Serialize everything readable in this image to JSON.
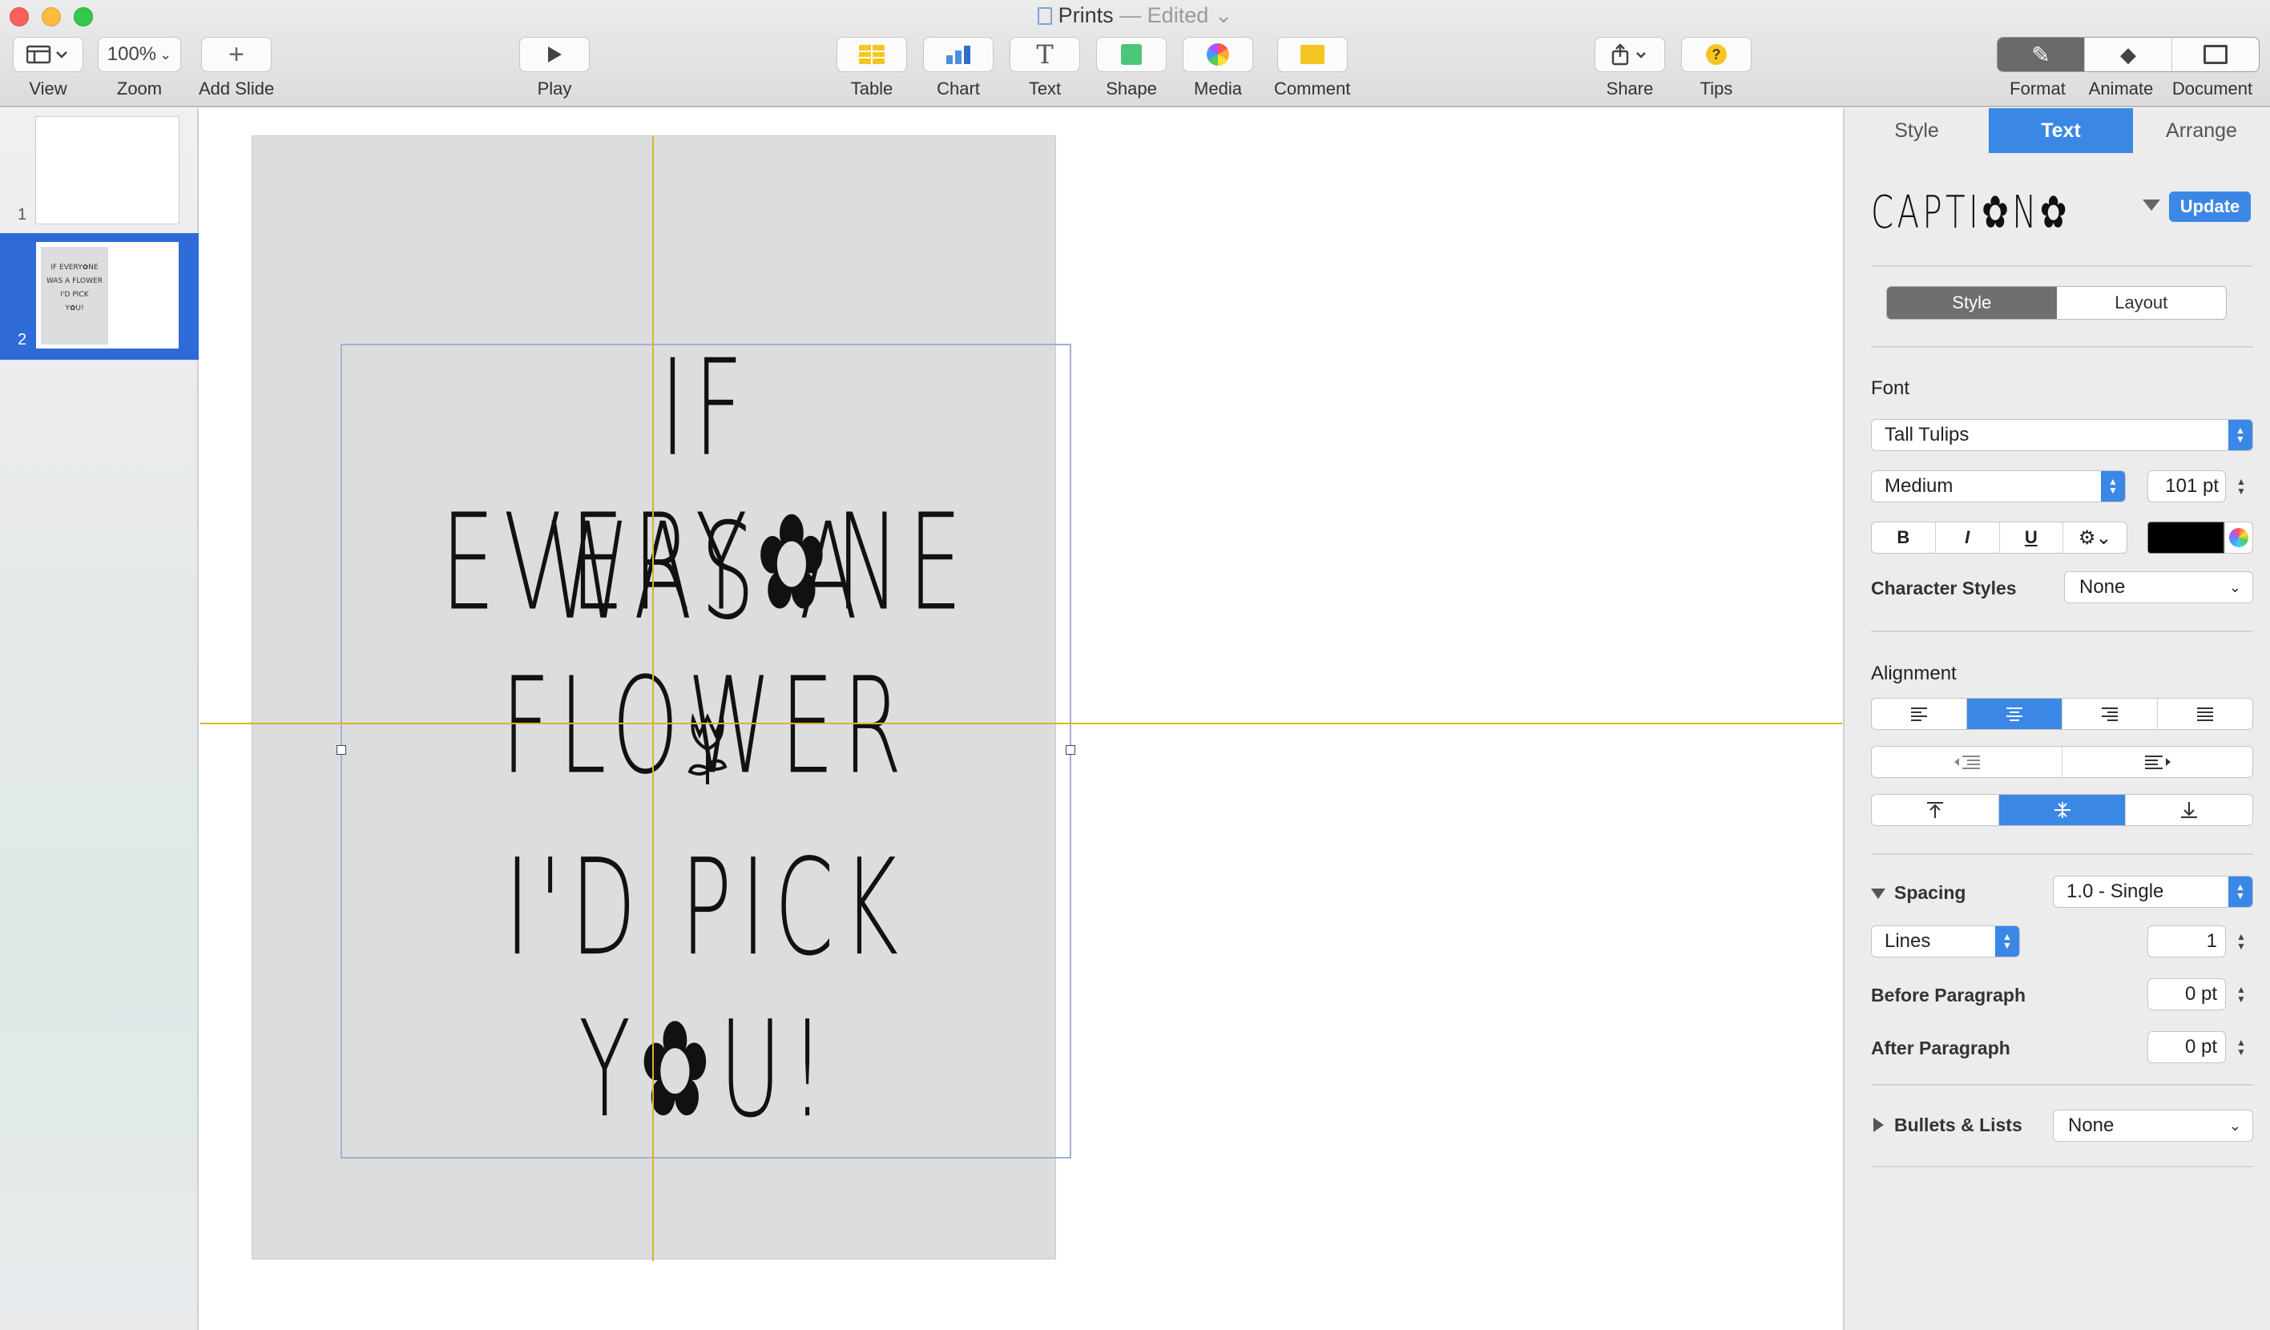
{
  "window": {
    "title": "Prints",
    "edited": "— Edited"
  },
  "toolbar": {
    "view": "View",
    "zoom": "Zoom",
    "zoom_value": "100%",
    "add_slide": "Add Slide",
    "play": "Play",
    "table": "Table",
    "chart": "Chart",
    "text": "Text",
    "shape": "Shape",
    "media": "Media",
    "comment": "Comment",
    "share": "Share",
    "tips": "Tips",
    "format": "Format",
    "animate": "Animate",
    "document": "Document"
  },
  "slides": [
    {
      "number": "1"
    },
    {
      "number": "2",
      "thumb_lines": [
        "IF EVERY✿NE",
        "WAS A FLOWER",
        "I'D PICK",
        "Y✿U!"
      ]
    }
  ],
  "slide_text": {
    "line1": "IF EVERY✿NE",
    "line2": "WAS A FLOWER",
    "line3": "I'D PICK",
    "line4": "Y✿U!"
  },
  "panel": {
    "tabs": [
      "Style",
      "Text",
      "Arrange"
    ],
    "style_preview": "CAPTI✿N✿",
    "update": "Update",
    "subtabs": [
      "Style",
      "Layout"
    ],
    "font_label": "Font",
    "font_name": "Tall Tulips",
    "font_weight": "Medium",
    "font_size": "101 pt",
    "bold": "B",
    "italic": "I",
    "underline": "U",
    "character_styles_label": "Character Styles",
    "character_styles_value": "None",
    "alignment_label": "Alignment",
    "spacing_label": "Spacing",
    "spacing_value": "1.0 - Single",
    "lines_value": "Lines",
    "lines_number": "1",
    "before_paragraph_label": "Before Paragraph",
    "before_paragraph_value": "0 pt",
    "after_paragraph_label": "After Paragraph",
    "after_paragraph_value": "0 pt",
    "bullets_label": "Bullets & Lists",
    "bullets_value": "None"
  },
  "colors": {
    "accent": "#3b87e6",
    "guide": "#d9b42a",
    "slide_bg": "#dcdddf",
    "text_color": "#000000"
  }
}
